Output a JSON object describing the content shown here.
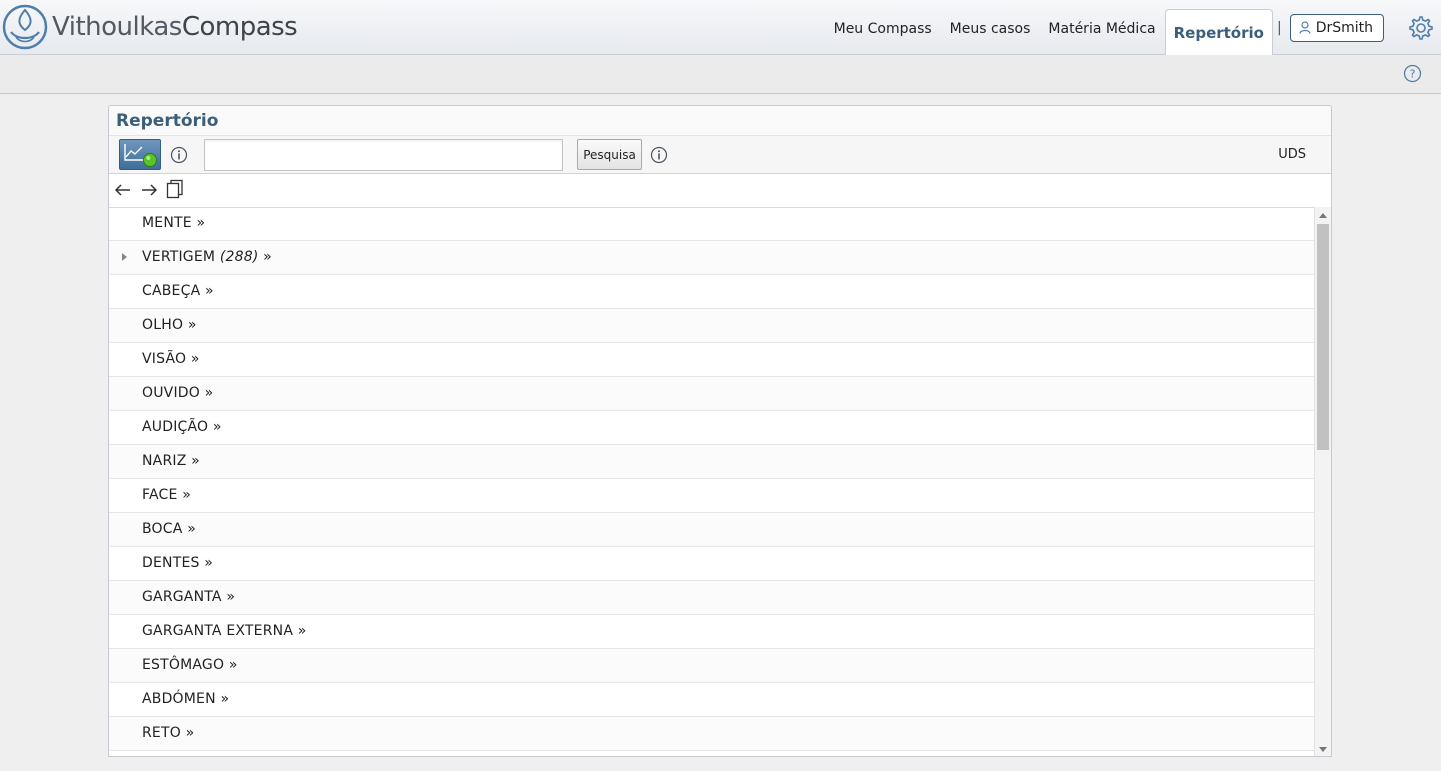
{
  "app": {
    "logo_part1": "Vithoulkas",
    "logo_part2": "Compass"
  },
  "nav": {
    "items": [
      {
        "label": "Meu Compass"
      },
      {
        "label": "Meus casos"
      },
      {
        "label": "Matéria Médica"
      },
      {
        "label": "Repertório"
      }
    ],
    "active": "Repertório",
    "separator": "|",
    "user": "DrSmith"
  },
  "panel": {
    "title": "Repertório",
    "search_placeholder": "",
    "search_button": "Pesquisa",
    "uds": "UDS"
  },
  "rubrics": [
    {
      "name": "MENTE",
      "count": "",
      "suffix": "»",
      "expandable": false
    },
    {
      "name": "VERTIGEM",
      "count": "(288)",
      "suffix": "»",
      "expandable": true
    },
    {
      "name": "CABEÇA",
      "count": "",
      "suffix": "»",
      "expandable": false
    },
    {
      "name": "OLHO",
      "count": "",
      "suffix": "»",
      "expandable": false
    },
    {
      "name": "VISÃO",
      "count": "",
      "suffix": "»",
      "expandable": false
    },
    {
      "name": "OUVIDO",
      "count": "",
      "suffix": "»",
      "expandable": false
    },
    {
      "name": "AUDIÇÃO",
      "count": "",
      "suffix": "»",
      "expandable": false
    },
    {
      "name": "NARIZ",
      "count": "",
      "suffix": "»",
      "expandable": false
    },
    {
      "name": "FACE",
      "count": "",
      "suffix": "»",
      "expandable": false
    },
    {
      "name": "BOCA",
      "count": "",
      "suffix": "»",
      "expandable": false
    },
    {
      "name": "DENTES",
      "count": "",
      "suffix": "»",
      "expandable": false
    },
    {
      "name": "GARGANTA",
      "count": "",
      "suffix": "»",
      "expandable": false
    },
    {
      "name": "GARGANTA EXTERNA",
      "count": "",
      "suffix": "»",
      "expandable": false
    },
    {
      "name": "ESTÔMAGO",
      "count": "",
      "suffix": "»",
      "expandable": false
    },
    {
      "name": "ABDÓMEN",
      "count": "",
      "suffix": "»",
      "expandable": false
    },
    {
      "name": "RETO",
      "count": "",
      "suffix": "»",
      "expandable": false
    }
  ],
  "icons": {
    "logo": "compass-logo-icon",
    "user": "user-icon",
    "settings": "gear-icon",
    "help": "help-icon",
    "graph": "chart-status-icon",
    "info": "info-icon",
    "back": "arrow-left-icon",
    "forward": "arrow-right-icon",
    "copy": "copy-icon"
  },
  "colors": {
    "accent": "#3b5f7a",
    "graph_button": "#4f7eaa",
    "status_dot": "#5bc22a"
  }
}
